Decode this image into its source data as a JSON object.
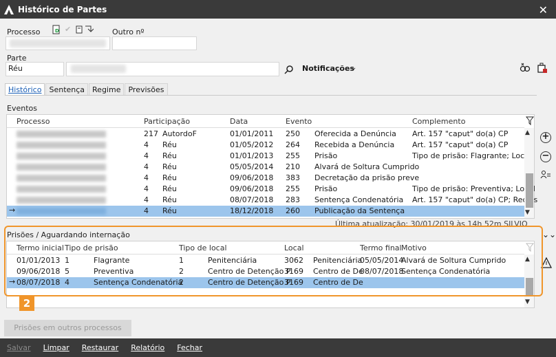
{
  "window": {
    "title": "Histórico de Partes"
  },
  "header": {
    "processo_label": "Processo",
    "outro_label": "Outro nº",
    "parte_label": "Parte",
    "parte_value": "Réu",
    "notificacoes_label": "Notificações"
  },
  "tabs": [
    {
      "label": "Histórico"
    },
    {
      "label": "Sentença"
    },
    {
      "label": "Regime"
    },
    {
      "label": "Previsões"
    }
  ],
  "eventos": {
    "section_label": "Eventos",
    "columns": [
      "Processo",
      "Participação",
      "Data",
      "Evento",
      "Complemento"
    ],
    "rows": [
      {
        "part_num": "217",
        "part": "AutordoF",
        "data": "01/01/2011",
        "ev_num": "250",
        "evento": "Oferecida a Denúncia",
        "complemento": "Art. 157 \"caput\" do(a) CP"
      },
      {
        "part_num": "4",
        "part": "Réu",
        "data": "01/05/2012",
        "ev_num": "264",
        "evento": "Recebida a Denúncia",
        "complemento": "Art. 157 \"caput\" do(a) CP"
      },
      {
        "part_num": "4",
        "part": "Réu",
        "data": "01/01/2013",
        "ev_num": "255",
        "evento": "Prisão",
        "complemento": "Tipo de prisão: Flagrante; Local"
      },
      {
        "part_num": "4",
        "part": "Réu",
        "data": "05/05/2014",
        "ev_num": "210",
        "evento": "Alvará de Soltura Cumprido",
        "complemento": ""
      },
      {
        "part_num": "4",
        "part": "Réu",
        "data": "09/06/2018",
        "ev_num": "383",
        "evento": "Decretação da prisão preve",
        "complemento": ""
      },
      {
        "part_num": "4",
        "part": "Réu",
        "data": "09/06/2018",
        "ev_num": "255",
        "evento": "Prisão",
        "complemento": "Tipo de prisão: Preventiva; Local"
      },
      {
        "part_num": "4",
        "part": "Réu",
        "data": "08/07/2018",
        "ev_num": "283",
        "evento": "Sentença Condenatória",
        "complemento": "Art. 157 \"caput\" do(a) CP; Reclus"
      },
      {
        "part_num": "4",
        "part": "Réu",
        "data": "18/12/2018",
        "ev_num": "260",
        "evento": "Publicação da Sentença",
        "complemento": ""
      }
    ],
    "last_update": "Última atualização: 30/01/2019 às 14h 52m     SILVIO"
  },
  "prisoes": {
    "section_label": "Prisões / Aguardando internação",
    "columns": [
      "Termo inicial",
      "Tipo de prisão",
      "Tipo de local",
      "Local",
      "Termo final",
      "Motivo"
    ],
    "rows": [
      {
        "inicio": "01/01/2013",
        "tipo_num": "1",
        "tipo": "Flagrante",
        "tlocal_num": "1",
        "tlocal": "Penitenciária",
        "local_num": "3062",
        "local": "Penitenciária",
        "fim": "05/05/2014",
        "motivo": "Alvará de Soltura Cumprido"
      },
      {
        "inicio": "09/06/2018",
        "tipo_num": "5",
        "tipo": "Preventiva",
        "tlocal_num": "2",
        "tlocal": "Centro de Detenção P",
        "local_num": "3169",
        "local": "Centro de De",
        "fim": "08/07/2018",
        "motivo": "Sentença Condenatória"
      },
      {
        "inicio": "08/07/2018",
        "tipo_num": "4",
        "tipo": "Sentença Condenatória",
        "tlocal_num": "2",
        "tlocal": "Centro de Detenção P",
        "local_num": "3169",
        "local": "Centro de De",
        "fim": "",
        "motivo": ""
      }
    ]
  },
  "badge": "2",
  "buttons": {
    "outros": "Prisões em outros processos",
    "salvar": "Salvar",
    "limpar": "Limpar",
    "restaurar": "Restaurar",
    "relatorio": "Relatório",
    "fechar": "Fechar"
  },
  "colors": {
    "accent": "#f0952a",
    "selection": "#9cc5ec",
    "titlebar": "#3a3a3a"
  }
}
